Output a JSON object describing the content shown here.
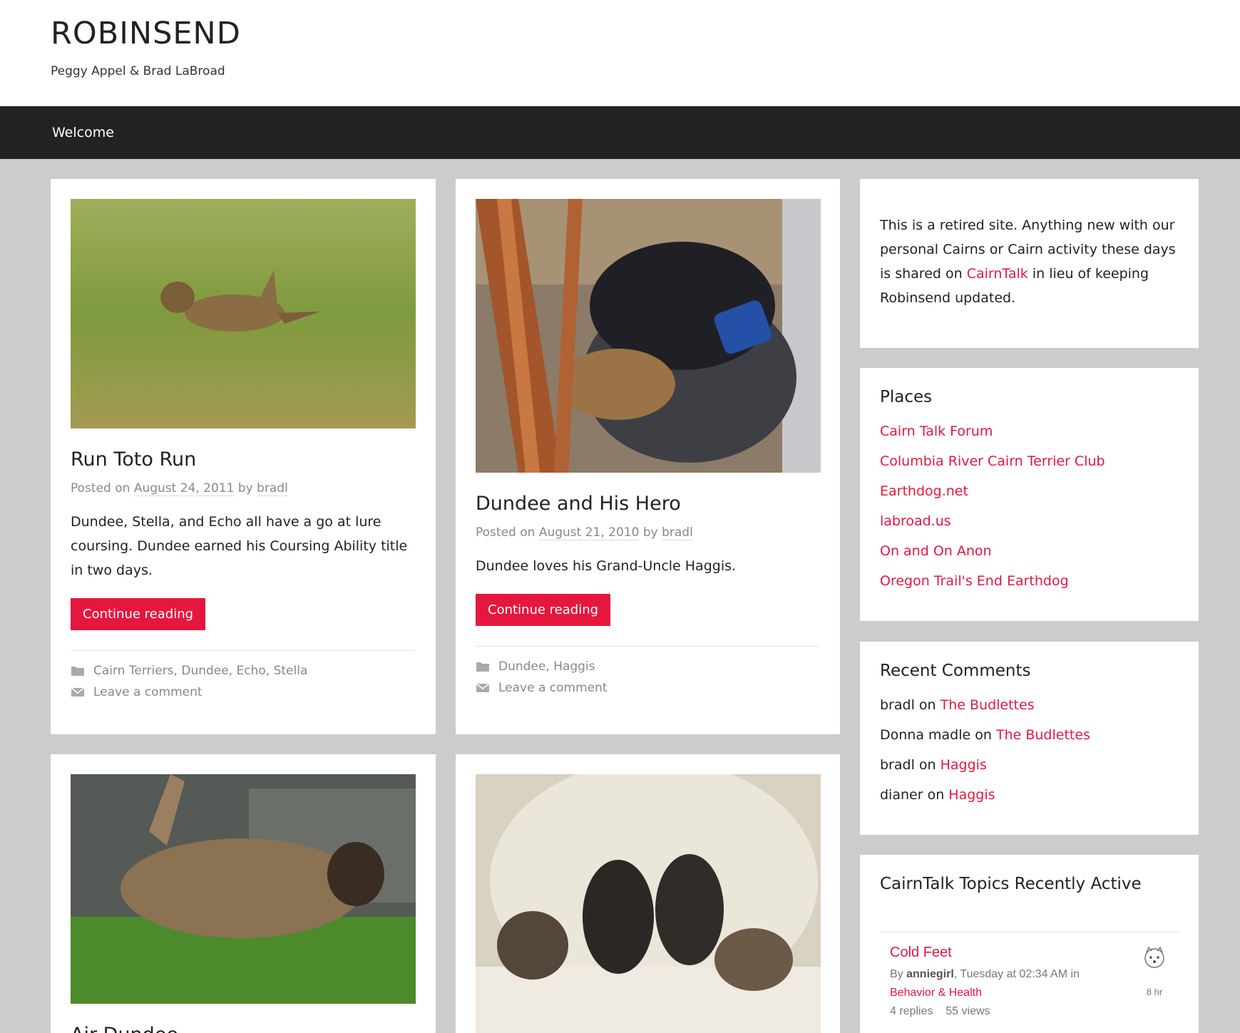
{
  "site": {
    "title": "ROBINSEND",
    "description": "Peggy Appel & Brad LaBroad"
  },
  "nav": {
    "items": [
      "Welcome"
    ]
  },
  "posts": [
    {
      "title": "Run Toto Run",
      "meta_prefix": "Posted on",
      "date": "August 24, 2011",
      "by": "by",
      "author": "bradl",
      "excerpt": "Dundee, Stella, and Echo all have a go at lure coursing. Dundee earned his Coursing Ability title in two days.",
      "button": "Continue reading",
      "categories": "Cairn Terriers, Dundee, Echo, Stella",
      "comment": "Leave a comment"
    },
    {
      "title": "Dundee and His Hero",
      "meta_prefix": "Posted on",
      "date": "August 21, 2010",
      "by": "by",
      "author": "bradl",
      "excerpt": "Dundee loves his Grand-Uncle Haggis.",
      "button": "Continue reading",
      "categories": "Dundee, Haggis",
      "comment": "Leave a comment"
    },
    {
      "title": "Air Dundee"
    },
    {
      "title": ""
    }
  ],
  "sidebar": {
    "intro": {
      "text_before": "This is a retired site. Anything new with our personal Cairns or Cairn activity these days is shared on ",
      "link": "CairnTalk",
      "text_after": " in lieu of keeping Robinsend updated."
    },
    "places": {
      "title": "Places",
      "links": [
        "Cairn Talk Forum",
        "Columbia River Cairn Terrier Club",
        "Earthdog.net",
        "labroad.us",
        "On and On Anon",
        "Oregon Trail's End Earthdog"
      ]
    },
    "recent_comments": {
      "title": "Recent Comments",
      "items": [
        {
          "author": "bradl",
          "on": "on",
          "post": "The Budlettes"
        },
        {
          "author": "Donna madle",
          "on": "on",
          "post": "The Budlettes"
        },
        {
          "author": "bradl",
          "on": "on",
          "post": "Haggis"
        },
        {
          "author": "dianer",
          "on": "on",
          "post": "Haggis"
        }
      ]
    },
    "cairntalk": {
      "title": "CairnTalk Topics Recently Active",
      "topic": {
        "title": "Cold Feet",
        "by": "By",
        "author": "anniegirl",
        "when": ", Tuesday at 02:34 AM in",
        "forum": "Behavior & Health",
        "replies": "4 replies",
        "views": "55 views",
        "age": "8 hr"
      }
    }
  },
  "colors": {
    "accent": "#e5173f",
    "nav_bg": "#222222",
    "page_bg": "#cccccc"
  },
  "icons": {
    "category": "folder-icon",
    "comment": "envelope-icon"
  }
}
